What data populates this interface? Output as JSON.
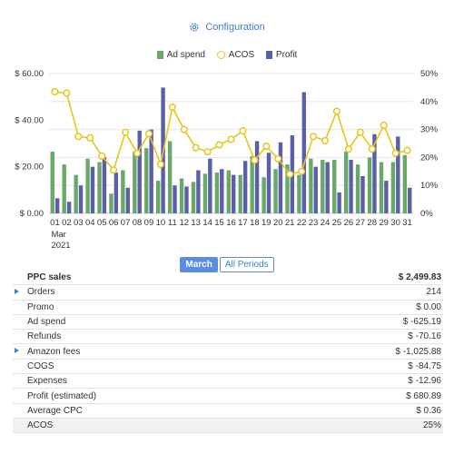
{
  "config": {
    "label": "Configuration",
    "icon": "gear-icon"
  },
  "legend": [
    {
      "label": "Ad spend",
      "color": "#6aa86a"
    },
    {
      "label": "ACOS",
      "color": "#e6c619"
    },
    {
      "label": "Profit",
      "color": "#5a5fa9"
    }
  ],
  "chart_data": {
    "type": "bar",
    "categories": [
      "01",
      "02",
      "03",
      "04",
      "05",
      "06",
      "07",
      "08",
      "09",
      "10",
      "11",
      "12",
      "13",
      "14",
      "15",
      "16",
      "17",
      "18",
      "19",
      "20",
      "21",
      "22",
      "23",
      "24",
      "25",
      "26",
      "27",
      "28",
      "29",
      "30",
      "31"
    ],
    "x_caption": [
      "Mar",
      "2021"
    ],
    "series": [
      {
        "name": "Ad spend",
        "type": "bar",
        "axis": "left",
        "values": [
          26.5,
          21,
          16.5,
          23.5,
          22,
          8.5,
          18.5,
          26.5,
          28,
          14,
          31,
          15,
          13.5,
          17,
          17.5,
          18.5,
          16.5,
          24.5,
          15.5,
          19,
          21,
          16.5,
          23.5,
          23,
          23,
          26.5,
          21,
          24,
          22,
          22,
          25
        ]
      },
      {
        "name": "Profit",
        "type": "bar",
        "axis": "left",
        "values": [
          6.5,
          5,
          12,
          20,
          24,
          17.5,
          11,
          35.5,
          36,
          54,
          12,
          11.5,
          18.5,
          23.5,
          19,
          16.5,
          22.5,
          31,
          26,
          30.5,
          33.5,
          52,
          20,
          22,
          9,
          23,
          16,
          34,
          14,
          33,
          11
        ]
      },
      {
        "name": "ACOS",
        "type": "line",
        "axis": "right",
        "values": [
          43.5,
          43,
          27.5,
          27,
          20.5,
          15.5,
          29,
          21.5,
          28.5,
          17.5,
          38,
          30,
          23.5,
          22,
          24.5,
          26.5,
          29.5,
          19,
          24,
          19.5,
          14,
          15,
          27.5,
          26,
          36.5,
          23,
          29,
          23,
          31.5,
          21.5,
          22.5
        ]
      }
    ],
    "y_left": {
      "ticks": [
        "$ 0.00",
        "$ 20.00",
        "$ 40.00",
        "$ 60.00"
      ],
      "ylim": [
        0,
        60
      ]
    },
    "y_right": {
      "ticks": [
        "0%",
        "10%",
        "20%",
        "30%",
        "40%",
        "50%"
      ],
      "ylim": [
        0,
        50
      ]
    },
    "grid": true,
    "legend_position": "top-center"
  },
  "periods": {
    "active": "March",
    "inactive": "All Periods"
  },
  "summary": {
    "header": {
      "label": "PPC sales",
      "value": "$ 2,499.83"
    },
    "rows": [
      {
        "label": "Orders",
        "value": "214",
        "expandable": true
      },
      {
        "label": "Promo",
        "value": "$ 0.00",
        "expandable": false
      },
      {
        "label": "Ad spend",
        "value": "$ -625.19",
        "expandable": false
      },
      {
        "label": "Refunds",
        "value": "$ -70.16",
        "expandable": false
      },
      {
        "label": "Amazon fees",
        "value": "$ -1,025.88",
        "expandable": true
      },
      {
        "label": "COGS",
        "value": "$ -84.75",
        "expandable": false
      },
      {
        "label": "Expenses",
        "value": "$ -12.96",
        "expandable": false
      },
      {
        "label": "Profit (estimated)",
        "value": "$ 680.89",
        "expandable": false
      },
      {
        "label": "Average CPC",
        "value": "$ 0.36",
        "expandable": false
      },
      {
        "label": "ACOS",
        "value": "25%",
        "expandable": false
      }
    ]
  }
}
